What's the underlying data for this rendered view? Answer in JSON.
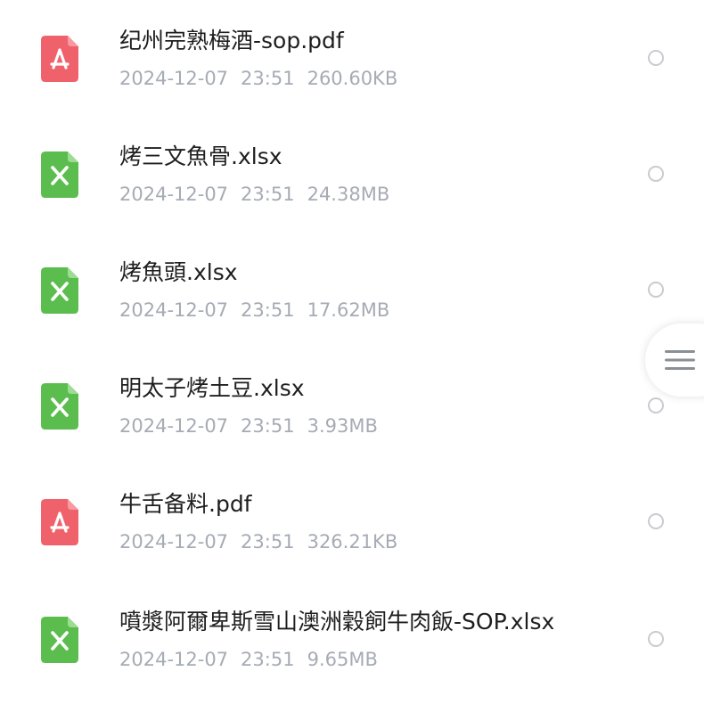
{
  "files": [
    {
      "name": "纪州完熟梅酒-sop.pdf",
      "date": "2024-12-07",
      "time": "23:51",
      "size": "260.60KB",
      "type": "pdf",
      "icon": "pdf-file-icon"
    },
    {
      "name": "烤三文魚骨.xlsx",
      "date": "2024-12-07",
      "time": "23:51",
      "size": "24.38MB",
      "type": "xlsx",
      "icon": "excel-file-icon"
    },
    {
      "name": "烤魚頭.xlsx",
      "date": "2024-12-07",
      "time": "23:51",
      "size": "17.62MB",
      "type": "xlsx",
      "icon": "excel-file-icon"
    },
    {
      "name": "明太子烤土豆.xlsx",
      "date": "2024-12-07",
      "time": "23:51",
      "size": "3.93MB",
      "type": "xlsx",
      "icon": "excel-file-icon"
    },
    {
      "name": "牛舌备料.pdf",
      "date": "2024-12-07",
      "time": "23:51",
      "size": "326.21KB",
      "type": "pdf",
      "icon": "pdf-file-icon"
    },
    {
      "name": "噴漿阿爾卑斯雪山澳洲穀飼牛肉飯-SOP.xlsx",
      "date": "2024-12-07",
      "time": "23:51",
      "size": "9.65MB",
      "type": "xlsx",
      "icon": "excel-file-icon"
    }
  ],
  "side_handle": {
    "icon": "hamburger-menu-icon"
  },
  "colors": {
    "pdf": "#f0626b",
    "xlsx": "#5cbd4f",
    "text_primary": "#1e1e1e",
    "text_secondary": "#a6abb4",
    "radio_border": "#c8cbd0"
  }
}
